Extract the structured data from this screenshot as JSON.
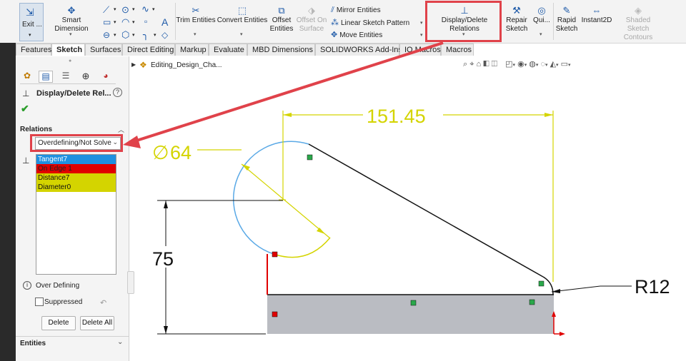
{
  "ribbon": {
    "exit_label": "Exit ...",
    "smart_dimension": "Smart Dimension",
    "trim_entities": "Trim Entities",
    "convert_entities": "Convert Entities",
    "offset_entities_1": "Offset",
    "offset_entities_2": "Entities",
    "offset_on_surface_1": "Offset On",
    "offset_on_surface_2": "Surface",
    "mirror_entities": "Mirror Entities",
    "linear_sketch_pattern": "Linear Sketch Pattern",
    "move_entities": "Move Entities",
    "display_delete_relations": "Display/Delete Relations",
    "repair_sketch_1": "Repair",
    "repair_sketch_2": "Sketch",
    "quick_snaps": "Qui...",
    "rapid_sketch_1": "Rapid",
    "rapid_sketch_2": "Sketch",
    "instant2d": "Instant2D",
    "shaded_contours_1": "Shaded Sketch",
    "shaded_contours_2": "Contours"
  },
  "tabs": [
    "Features",
    "Sketch",
    "Surfaces",
    "Direct Editing",
    "Markup",
    "Evaluate",
    "MBD Dimensions",
    "SOLIDWORKS Add-Ins",
    "IQ Macros",
    "Macros"
  ],
  "breadcrumb": "Editing_Design_Cha...",
  "pm": {
    "title": "Display/Delete Rel...",
    "relations_header": "Relations",
    "filter_selected": "Overdefining/Not Solve",
    "relations": [
      {
        "label": "Tangent7",
        "color": "#1e90e0"
      },
      {
        "label": "On Edge 1",
        "color": "#e00000"
      },
      {
        "label": "Distance7",
        "color": "#d4d400"
      },
      {
        "label": "Diameter0",
        "color": "#d4d400"
      }
    ],
    "status": "Over Defining",
    "suppressed": "Suppressed",
    "delete": "Delete",
    "delete_all": "Delete All",
    "entities_header": "Entities"
  },
  "dims": {
    "horizontal": "151.45",
    "diameter": "64",
    "vertical": "75",
    "radius": "R12"
  },
  "colors": {
    "highlight": "#e0424a",
    "dim_yellow": "#d4d400",
    "arc_blue": "#5aa9e6",
    "body_fill": "#babcc2"
  }
}
